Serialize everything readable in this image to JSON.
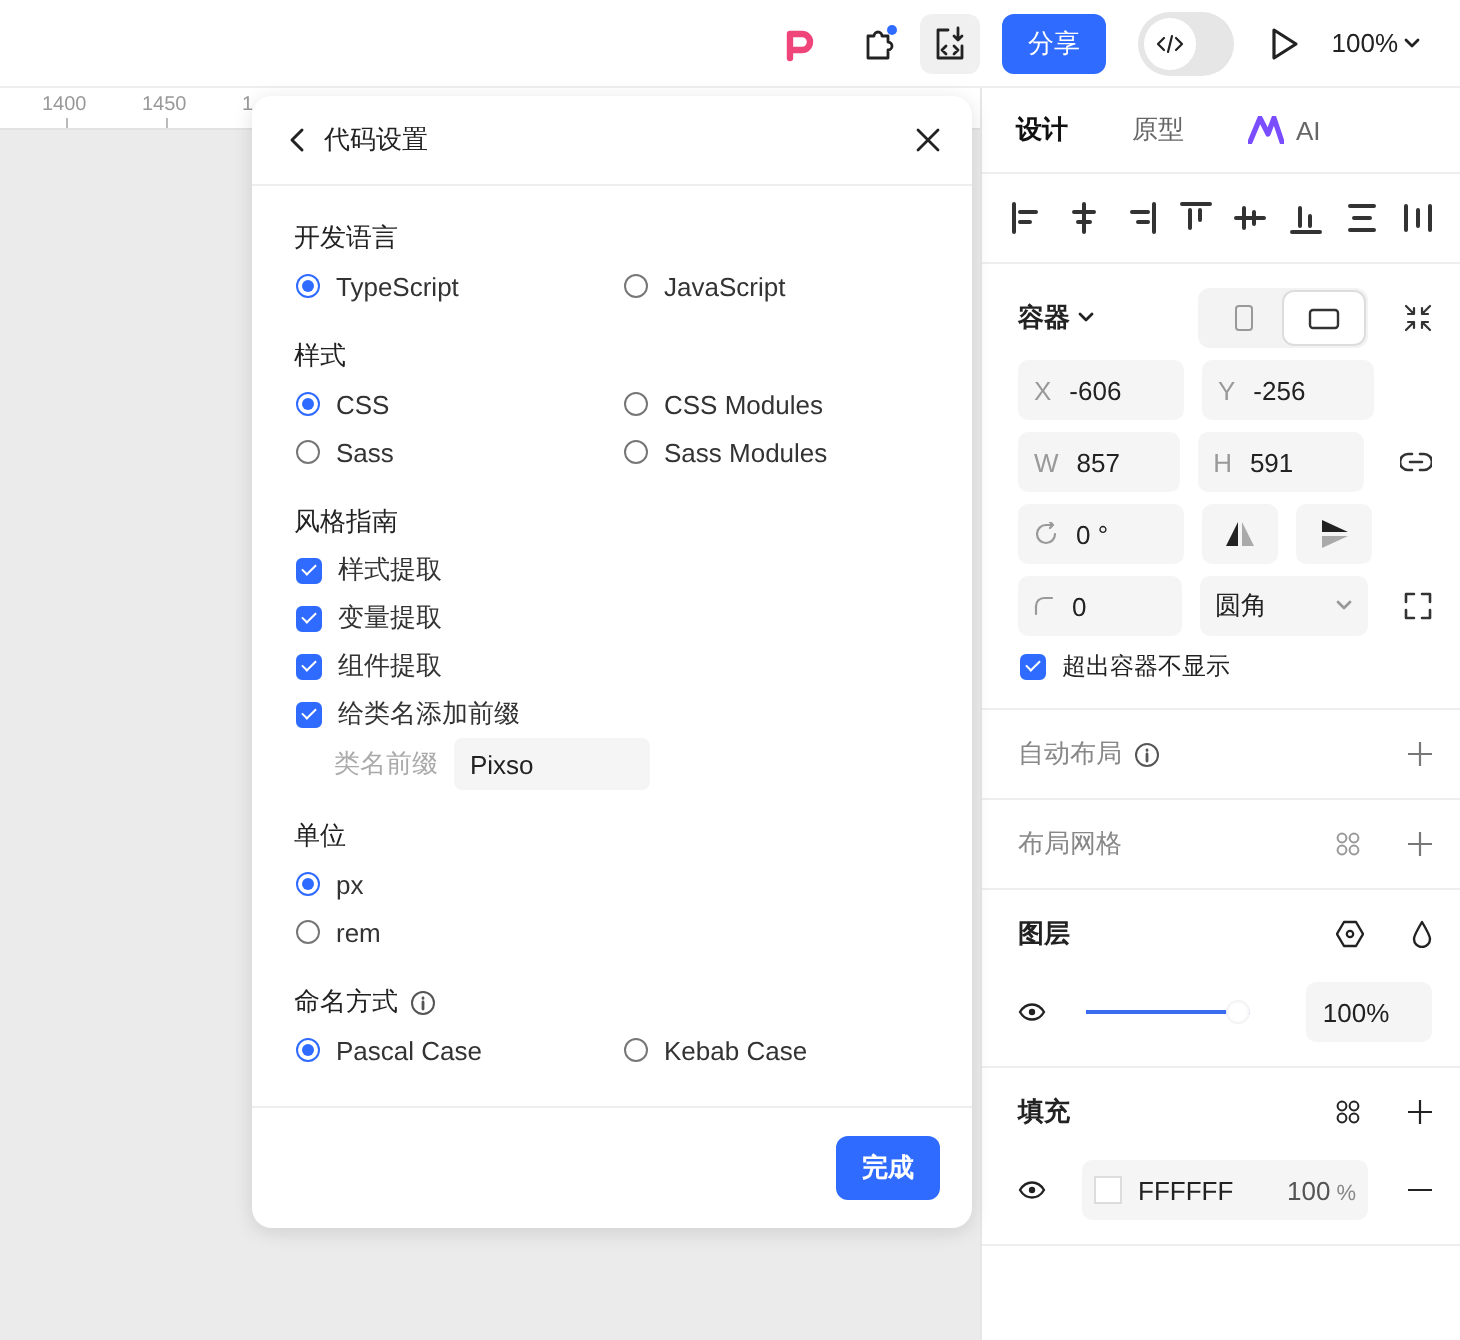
{
  "toolbar": {
    "share_button": "分享",
    "dev_mode_toggle": {
      "on": false
    },
    "zoom": "100%"
  },
  "ruler": {
    "labels": [
      "1400",
      "1450",
      "1"
    ]
  },
  "dialog": {
    "title": "代码设置",
    "sections": [
      {
        "title": "开发语言",
        "kind": "radio-grid",
        "info": false,
        "options": [
          {
            "label": "TypeScript",
            "selected": true
          },
          {
            "label": "JavaScript",
            "selected": false
          }
        ]
      },
      {
        "title": "样式",
        "kind": "radio-grid",
        "info": false,
        "options": [
          {
            "label": "CSS",
            "selected": true
          },
          {
            "label": "CSS Modules",
            "selected": false
          },
          {
            "label": "Sass",
            "selected": false
          },
          {
            "label": "Sass Modules",
            "selected": false
          }
        ]
      },
      {
        "title": "风格指南",
        "kind": "checkbox-list",
        "info": false,
        "options": [
          {
            "label": "样式提取",
            "checked": true
          },
          {
            "label": "变量提取",
            "checked": true
          },
          {
            "label": "组件提取",
            "checked": true
          },
          {
            "label": "给类名添加前缀",
            "checked": true
          }
        ],
        "prefix": {
          "label": "类名前缀",
          "value": "Pixso"
        }
      },
      {
        "title": "单位",
        "kind": "radio-list",
        "info": false,
        "options": [
          {
            "label": "px",
            "selected": true
          },
          {
            "label": "rem",
            "selected": false
          }
        ]
      },
      {
        "title": "命名方式",
        "kind": "radio-grid",
        "info": true,
        "options": [
          {
            "label": "Pascal Case",
            "selected": true
          },
          {
            "label": "Kebab Case",
            "selected": false
          }
        ]
      }
    ],
    "done_button": "完成"
  },
  "panel": {
    "tabs": [
      {
        "label": "设计",
        "kind": "text",
        "selected": true
      },
      {
        "label": "原型",
        "kind": "text",
        "selected": false
      },
      {
        "label": "AI",
        "kind": "ai",
        "selected": false
      }
    ],
    "container": {
      "title": "容器",
      "orientations": [
        {
          "kind": "portrait",
          "selected": false
        },
        {
          "kind": "landscape",
          "selected": true
        }
      ],
      "fields": [
        {
          "label": "X",
          "value": "-606"
        },
        {
          "label": "Y",
          "value": "-256"
        },
        {
          "label": "W",
          "value": "857"
        },
        {
          "label": "H",
          "value": "591"
        }
      ],
      "rotation": "0 °",
      "corner_radius": "0",
      "corner_type": "圆角",
      "clip": {
        "label": "超出容器不显示",
        "checked": true
      }
    },
    "auto_layout": {
      "title": "自动布局"
    },
    "layout_grid": {
      "title": "布局网格"
    },
    "layer": {
      "title": "图层",
      "opacity": {
        "level": 1,
        "reading": "100%"
      }
    },
    "fill": {
      "title": "填充",
      "items": [
        {
          "hex": "FFFFFF",
          "opacity": "100",
          "unit": "%"
        }
      ]
    }
  }
}
